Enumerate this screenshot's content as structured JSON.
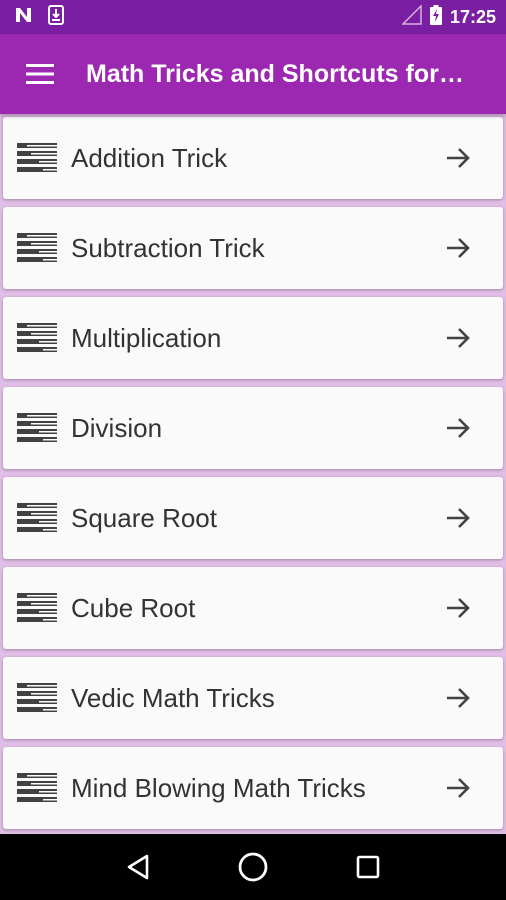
{
  "status_bar": {
    "time": "17:25",
    "icons": [
      "notification-n-icon",
      "download-icon",
      "signal-icon",
      "battery-charging-icon"
    ]
  },
  "app_bar": {
    "title": "Math Tricks and Shortcuts for…",
    "menu_icon": "hamburger-menu-icon",
    "color": "#9c27b0"
  },
  "list": {
    "items": [
      {
        "label": "Addition Trick",
        "icon": "list-lines-icon",
        "arrow": "arrow-right-icon"
      },
      {
        "label": "Subtraction Trick",
        "icon": "list-lines-icon",
        "arrow": "arrow-right-icon"
      },
      {
        "label": "Multiplication",
        "icon": "list-lines-icon",
        "arrow": "arrow-right-icon"
      },
      {
        "label": "Division",
        "icon": "list-lines-icon",
        "arrow": "arrow-right-icon"
      },
      {
        "label": "Square Root",
        "icon": "list-lines-icon",
        "arrow": "arrow-right-icon"
      },
      {
        "label": "Cube Root",
        "icon": "list-lines-icon",
        "arrow": "arrow-right-icon"
      },
      {
        "label": "Vedic Math Tricks",
        "icon": "list-lines-icon",
        "arrow": "arrow-right-icon"
      },
      {
        "label": "Mind Blowing Math Tricks",
        "icon": "list-lines-icon",
        "arrow": "arrow-right-icon"
      }
    ],
    "background": "#e1bee7"
  },
  "nav_bar": {
    "icons": [
      "back-icon",
      "home-icon",
      "recents-icon"
    ]
  }
}
